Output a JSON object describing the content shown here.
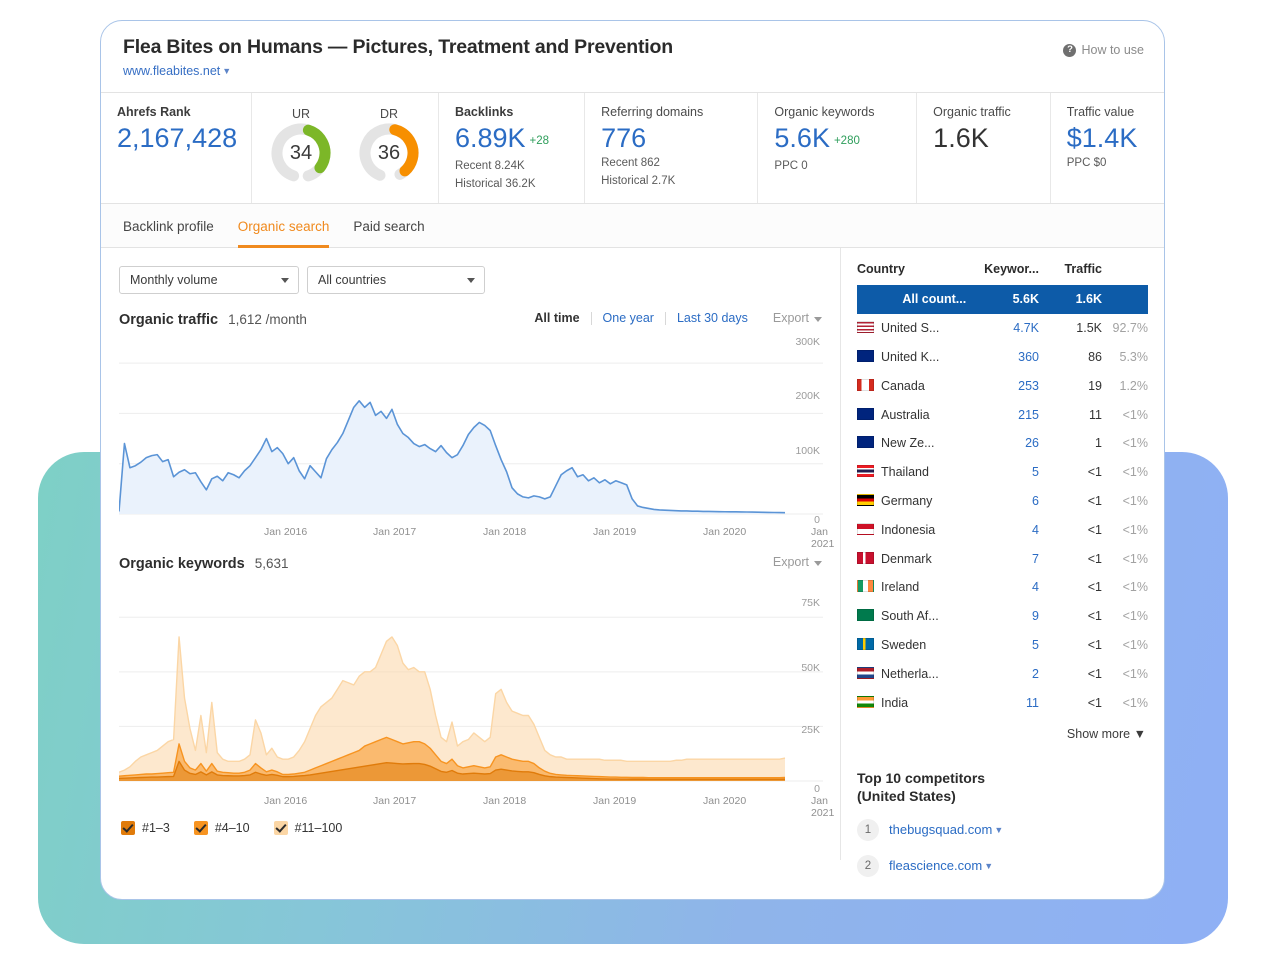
{
  "header": {
    "title": "Flea Bites on Humans — Pictures, Treatment and Prevention",
    "domain": "www.fleabites.net",
    "howto": "How to use",
    "howto_icon": "question-circle-icon"
  },
  "metrics": {
    "rank": {
      "label": "Ahrefs Rank",
      "value": "2,167,428"
    },
    "ur": {
      "label": "UR",
      "value": "34",
      "percent": 34,
      "color": "#7cb728"
    },
    "dr": {
      "label": "DR",
      "value": "36",
      "percent": 36,
      "color": "#f78f00"
    },
    "backlinks": {
      "label": "Backlinks",
      "value": "6.89K",
      "delta": "+28",
      "sub1": "Recent 8.24K",
      "sub2": "Historical 36.2K"
    },
    "referring_domains": {
      "label": "Referring domains",
      "value": "776",
      "sub1": "Recent 862",
      "sub2": "Historical 2.7K"
    },
    "organic_keywords": {
      "label": "Organic keywords",
      "value": "5.6K",
      "delta": "+280",
      "sub1": "PPC 0"
    },
    "organic_traffic": {
      "label": "Organic traffic",
      "value": "1.6K"
    },
    "traffic_value": {
      "label": "Traffic value",
      "value": "$1.4K",
      "sub1": "PPC $0"
    }
  },
  "tabs": [
    {
      "label": "Backlink profile",
      "active": false
    },
    {
      "label": "Organic search",
      "active": true
    },
    {
      "label": "Paid search",
      "active": false
    }
  ],
  "filters": {
    "volume": "Monthly volume",
    "country": "All countries"
  },
  "traffic_section": {
    "title": "Organic traffic",
    "value": "1,612 /month",
    "ranges": [
      "All time",
      "One year",
      "Last 30 days"
    ],
    "active_range": "All time",
    "export": "Export"
  },
  "keywords_section": {
    "title": "Organic keywords",
    "value": "5,631",
    "export": "Export"
  },
  "legend": [
    {
      "label": "#1–3",
      "color": "#e07b0a"
    },
    {
      "label": "#4–10",
      "color": "#f79421"
    },
    {
      "label": "#11–100",
      "color": "#fbd6a5"
    }
  ],
  "country_table": {
    "columns": [
      "Country",
      "Keywor...",
      "Traffic"
    ],
    "rows": [
      {
        "country": "All count...",
        "keywords": "5.6K",
        "traffic": "1.6K",
        "share": "",
        "selected": true,
        "flag": null
      },
      {
        "country": "United S...",
        "keywords": "4.7K",
        "traffic": "1.5K",
        "share": "92.7%",
        "flag": "us"
      },
      {
        "country": "United K...",
        "keywords": "360",
        "traffic": "86",
        "share": "5.3%",
        "flag": "gb"
      },
      {
        "country": "Canada",
        "keywords": "253",
        "traffic": "19",
        "share": "1.2%",
        "flag": "ca"
      },
      {
        "country": "Australia",
        "keywords": "215",
        "traffic": "11",
        "share": "<1%",
        "flag": "au"
      },
      {
        "country": "New Ze...",
        "keywords": "26",
        "traffic": "1",
        "share": "<1%",
        "flag": "nz"
      },
      {
        "country": "Thailand",
        "keywords": "5",
        "traffic": "<1",
        "share": "<1%",
        "flag": "th"
      },
      {
        "country": "Germany",
        "keywords": "6",
        "traffic": "<1",
        "share": "<1%",
        "flag": "de"
      },
      {
        "country": "Indonesia",
        "keywords": "4",
        "traffic": "<1",
        "share": "<1%",
        "flag": "id"
      },
      {
        "country": "Denmark",
        "keywords": "7",
        "traffic": "<1",
        "share": "<1%",
        "flag": "dk"
      },
      {
        "country": "Ireland",
        "keywords": "4",
        "traffic": "<1",
        "share": "<1%",
        "flag": "ie"
      },
      {
        "country": "South Af...",
        "keywords": "9",
        "traffic": "<1",
        "share": "<1%",
        "flag": "za"
      },
      {
        "country": "Sweden",
        "keywords": "5",
        "traffic": "<1",
        "share": "<1%",
        "flag": "se"
      },
      {
        "country": "Netherla...",
        "keywords": "2",
        "traffic": "<1",
        "share": "<1%",
        "flag": "nl"
      },
      {
        "country": "India",
        "keywords": "11",
        "traffic": "<1",
        "share": "<1%",
        "flag": "in"
      }
    ],
    "show_more": "Show more"
  },
  "competitors": {
    "title_line1": "Top 10 competitors",
    "title_line2": "(United States)",
    "items": [
      {
        "rank": "1",
        "domain": "thebugsquad.com"
      },
      {
        "rank": "2",
        "domain": "fleascience.com"
      }
    ]
  },
  "chart_data": [
    {
      "type": "area",
      "id": "organic-traffic",
      "title": "Organic traffic",
      "ylabel": "",
      "xlabel": "",
      "ylim": [
        0,
        330000
      ],
      "yticks": [
        0,
        100000,
        200000,
        300000
      ],
      "ytick_labels": [
        "0",
        "100K",
        "200K",
        "300K"
      ],
      "grid": true,
      "xticks": [
        "Jan 2016",
        "Jan 2017",
        "Jan 2018",
        "Jan 2019",
        "Jan 2020",
        "Jan 2021"
      ],
      "line_color": "#5b94d6",
      "fill_color": "#eaf2fc",
      "series": [
        {
          "name": "Organic traffic",
          "values": [
            5000,
            140000,
            92000,
            96000,
            103000,
            112000,
            116000,
            118000,
            104000,
            108000,
            74000,
            83000,
            88000,
            80000,
            82000,
            64000,
            48000,
            70000,
            75000,
            66000,
            82000,
            78000,
            72000,
            86000,
            96000,
            112000,
            128000,
            150000,
            124000,
            132000,
            120000,
            100000,
            112000,
            86000,
            70000,
            96000,
            84000,
            72000,
            110000,
            128000,
            142000,
            160000,
            186000,
            212000,
            225000,
            212000,
            222000,
            196000,
            204000,
            190000,
            208000,
            178000,
            160000,
            152000,
            140000,
            134000,
            138000,
            130000,
            124000,
            136000,
            122000,
            112000,
            118000,
            136000,
            158000,
            172000,
            182000,
            176000,
            166000,
            136000,
            108000,
            84000,
            52000,
            40000,
            34000,
            32000,
            36000,
            34000,
            30000,
            34000,
            56000,
            78000,
            86000,
            92000,
            74000,
            78000,
            66000,
            72000,
            62000,
            68000,
            60000,
            66000,
            62000,
            58000,
            30000,
            16000,
            13000,
            11000,
            9000,
            8000,
            7500,
            7000,
            6500,
            6000,
            6000,
            5500,
            5500,
            5000,
            5000,
            4800,
            4600,
            4500,
            4400,
            4300,
            4200,
            4000,
            3800,
            3600,
            3400,
            3200,
            3000,
            2800,
            2600
          ]
        }
      ]
    },
    {
      "type": "stacked-area",
      "id": "organic-keywords",
      "title": "Organic keywords",
      "ylabel": "",
      "xlabel": "",
      "ylim": [
        0,
        82000
      ],
      "yticks": [
        0,
        25000,
        50000,
        75000
      ],
      "ytick_labels": [
        "0",
        "25K",
        "50K",
        "75K"
      ],
      "grid": true,
      "xticks": [
        "Jan 2016",
        "Jan 2017",
        "Jan 2018",
        "Jan 2019",
        "Jan 2020",
        "Jan 2021"
      ],
      "series": [
        {
          "name": "#11–100",
          "color": "#fbd6a5",
          "values": [
            4000,
            5000,
            6500,
            9000,
            11000,
            12000,
            13000,
            14000,
            16000,
            18000,
            19000,
            66000,
            38000,
            24000,
            14000,
            30000,
            13000,
            36000,
            13000,
            10000,
            9000,
            9000,
            9000,
            10000,
            12000,
            28000,
            22000,
            12000,
            15000,
            11000,
            10000,
            10000,
            11000,
            14000,
            18000,
            24000,
            30000,
            34000,
            36000,
            38000,
            42000,
            46000,
            45000,
            44000,
            48000,
            50000,
            50000,
            52000,
            58000,
            64000,
            66000,
            62000,
            54000,
            51000,
            52000,
            50000,
            50000,
            42000,
            30000,
            20000,
            18000,
            27000,
            16000,
            18000,
            19000,
            22000,
            20000,
            18000,
            20000,
            40000,
            42000,
            36000,
            32000,
            31000,
            30000,
            30000,
            26000,
            20000,
            14000,
            12000,
            11000,
            11000,
            10000,
            10000,
            10000,
            10000,
            10000,
            10000,
            10000,
            9500,
            9500,
            9500,
            9500,
            9000,
            9000,
            9000,
            9000,
            9000,
            9000,
            9000,
            9000,
            9000,
            9500,
            9500,
            10000,
            10000,
            10000,
            10000,
            10000,
            10000,
            10000,
            10000,
            10000,
            10000,
            10000,
            10000,
            10000,
            10000,
            10000,
            10000,
            10000,
            10000,
            10500
          ]
        },
        {
          "name": "#4–10",
          "color": "#f79421",
          "values": [
            2200,
            2400,
            2600,
            2800,
            3000,
            3200,
            3200,
            3400,
            3600,
            3800,
            4000,
            17000,
            9000,
            6000,
            5000,
            8000,
            4500,
            8000,
            4500,
            4000,
            3800,
            3600,
            3600,
            4000,
            5000,
            8000,
            6000,
            4200,
            5000,
            4200,
            3000,
            3000,
            3200,
            3600,
            4000,
            5000,
            6000,
            7000,
            8000,
            9000,
            10000,
            11000,
            12000,
            13000,
            14000,
            16000,
            17000,
            18000,
            19000,
            20000,
            19000,
            18000,
            17000,
            17500,
            18000,
            18000,
            17000,
            15000,
            12000,
            9000,
            8000,
            10000,
            7000,
            6000,
            6500,
            7000,
            6500,
            6000,
            6500,
            11000,
            12000,
            11000,
            10000,
            9500,
            9000,
            9000,
            8000,
            6000,
            4500,
            3500,
            3000,
            2800,
            2600,
            2500,
            2400,
            2300,
            2200,
            2100,
            2000,
            1900,
            1800,
            1800,
            1700,
            1700,
            1600,
            1600,
            1600,
            1500,
            1500,
            1500,
            1500,
            1500,
            1500,
            1500,
            1500,
            1500,
            1500,
            1500,
            1500,
            1500,
            1500,
            1500,
            1500,
            1500,
            1500,
            1500,
            1500,
            1500,
            1500,
            1500,
            1500,
            1500,
            1600
          ]
        },
        {
          "name": "#1–3",
          "color": "#e07b0a",
          "values": [
            1200,
            1300,
            1400,
            1500,
            1600,
            1700,
            1800,
            1800,
            1900,
            2000,
            2100,
            9000,
            5000,
            3500,
            3000,
            4200,
            2800,
            4200,
            2800,
            2500,
            2400,
            2300,
            2300,
            2500,
            2800,
            4000,
            3200,
            2600,
            3000,
            2600,
            2000,
            2000,
            2100,
            2300,
            2500,
            2800,
            3200,
            3600,
            4000,
            4400,
            4800,
            5200,
            5600,
            6000,
            6400,
            6800,
            7200,
            7600,
            8000,
            8400,
            8200,
            8000,
            7800,
            7900,
            8000,
            8000,
            7600,
            6800,
            5600,
            4400,
            4000,
            4800,
            3600,
            3200,
            3400,
            3600,
            3400,
            3200,
            3400,
            5000,
            5400,
            5000,
            4600,
            4400,
            4200,
            4200,
            3800,
            3000,
            2400,
            2000,
            1800,
            1700,
            1600,
            1500,
            1400,
            1300,
            1200,
            1100,
            1000,
            950,
            900,
            900,
            850,
            850,
            800,
            800,
            800,
            750,
            750,
            750,
            750,
            750,
            750,
            750,
            750,
            750,
            750,
            750,
            750,
            750,
            750,
            750,
            750,
            750,
            750,
            750,
            750,
            750,
            750,
            750,
            750,
            750,
            800
          ]
        }
      ]
    }
  ]
}
